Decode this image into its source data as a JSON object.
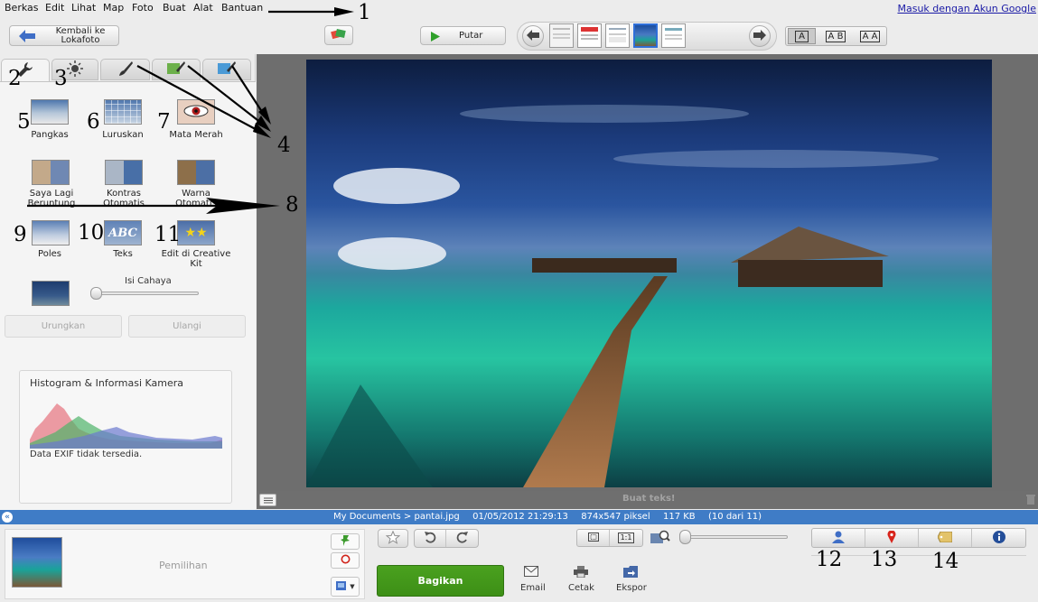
{
  "menu": {
    "items": [
      {
        "label": "Berkas"
      },
      {
        "label": "Edit"
      },
      {
        "label": "Lihat"
      },
      {
        "label": "Map"
      },
      {
        "label": "Foto"
      },
      {
        "label": "Buat"
      },
      {
        "label": "Alat"
      },
      {
        "label": "Bantuan"
      }
    ],
    "signin_link": "Masuk dengan Akun Google"
  },
  "toolbar": {
    "back_label_line1": "Kembali ke",
    "back_label_line2": "Lokafoto",
    "play_label": "Putar",
    "text_size_buttons": [
      "A",
      "A B",
      "A A"
    ]
  },
  "annotations": [
    "1",
    "2",
    "3",
    "4",
    "5",
    "6",
    "7",
    "8",
    "9",
    "10",
    "11",
    "12",
    "13",
    "14"
  ],
  "tools": {
    "row1": [
      {
        "label": "Pangkas"
      },
      {
        "label": "Luruskan"
      },
      {
        "label": "Mata Merah"
      }
    ],
    "row2": [
      {
        "label": "Saya Lagi Beruntung"
      },
      {
        "label": "Kontras Otomatis"
      },
      {
        "label": "Warna Otomatis"
      }
    ],
    "row3": [
      {
        "label": "Poles"
      },
      {
        "label": "Teks"
      },
      {
        "label": "Edit di Creative Kit"
      }
    ],
    "fill_light_label": "Isi Cahaya",
    "fill_light_value": 0,
    "undo_label": "Urungkan",
    "redo_label": "Ulangi"
  },
  "histogram": {
    "title": "Histogram & Informasi Kamera",
    "exif_note": "Data EXIF tidak tersedia."
  },
  "caption": {
    "placeholder": "Buat teks!"
  },
  "status": {
    "path": "My Documents > pantai.jpg",
    "datetime": "01/05/2012 21:29:13",
    "dimensions": "874x547 piksel",
    "size": "117 KB",
    "position": "(10 dari 11)"
  },
  "bottom": {
    "selection_label": "Pemilihan",
    "share_label": "Bagikan",
    "email_label": "Email",
    "print_label": "Cetak",
    "export_label": "Ekspor"
  },
  "colors": {
    "accent_green": "#3d8f16",
    "status_blue": "#3f7cc6",
    "link_blue": "#1a1aa6"
  }
}
